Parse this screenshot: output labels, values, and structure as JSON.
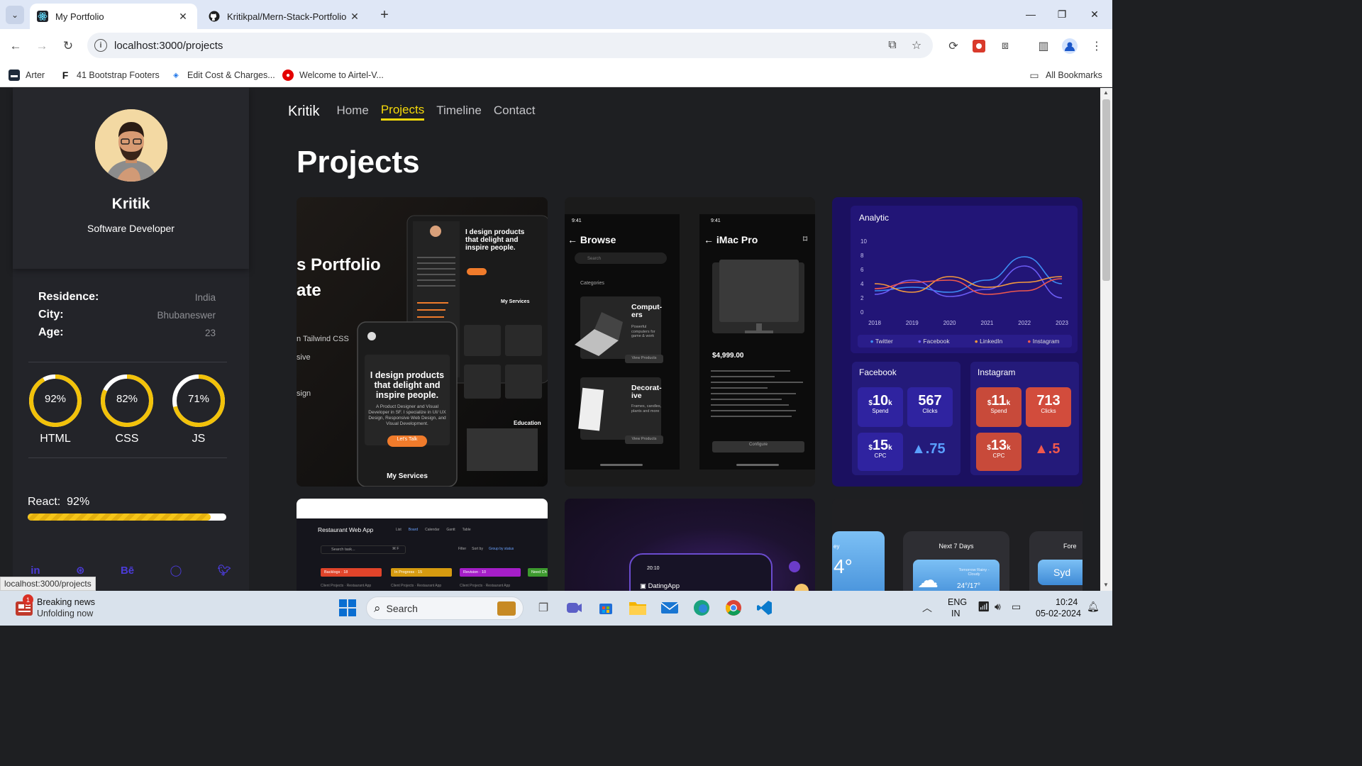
{
  "browser": {
    "tabs": [
      {
        "title": "My Portfolio",
        "active": true
      },
      {
        "title": "Kritikpal/Mern-Stack-Portfolio",
        "active": false
      }
    ],
    "url": "localhost:3000/projects",
    "bookmarks": [
      "Arter",
      "41 Bootstrap Footers",
      "Edit Cost & Charges...",
      "Welcome to Airtel-V..."
    ],
    "all_bookmarks": "All Bookmarks",
    "status_url": "localhost:3000/projects"
  },
  "sidebar": {
    "name": "Kritik",
    "role": "Software Developer",
    "info": [
      {
        "key": "Residence:",
        "value": "India"
      },
      {
        "key": "City:",
        "value": "Bhubaneswer"
      },
      {
        "key": "Age:",
        "value": "23"
      }
    ],
    "skills": [
      {
        "label": "HTML",
        "percent": "92%",
        "value": 0.92
      },
      {
        "label": "CSS",
        "percent": "82%",
        "value": 0.82
      },
      {
        "label": "JS",
        "percent": "71%",
        "value": 0.71
      }
    ],
    "bar_skill": {
      "label": "React:",
      "percent": "92%",
      "value": 0.92
    },
    "socials": [
      "in",
      "dribbble",
      "Bē",
      "github",
      "twitter"
    ]
  },
  "nav": {
    "brand": "Kritik",
    "links": [
      "Home",
      "Projects",
      "Timeline",
      "Contact"
    ],
    "active": "Projects"
  },
  "page_title": "Projects",
  "projects": {
    "portfolio": {
      "heading_partial_1": "s Portfolio",
      "heading_partial_2": "ate",
      "side_line_1": "n Tailwind CSS",
      "side_line_2": "sive",
      "side_line_3": "sign",
      "hero": "I design products that delight and inspire people.",
      "hero_small": "I design products that delight and inspire people.",
      "hero_desc": "A Product Designer and Visual Developer in SF. I specialize in UI/ UX Design, Responsive Web Design, and Visual Development.",
      "cta": "Let's Talk",
      "services": "My Services",
      "services_small": "My Services",
      "education": "Education"
    },
    "shop": {
      "time": "9:41",
      "browse": "Browse",
      "search_placeholder": "Search",
      "categories": "Categories",
      "cat1_title": "Comput-ers",
      "cat1_desc": "Powerful computers for game & work",
      "cat2_title": "Decorat-ive",
      "cat2_desc": "Frames, candles, plants and more",
      "view_products": "View Products",
      "product_title": "iMac Pro",
      "price": "$4,999.00",
      "configure": "Configure"
    },
    "analytics": {
      "title": "Analytic",
      "legend": [
        "Twitter",
        "Facebook",
        "LinkedIn",
        "Instagram"
      ],
      "facebook_title": "Facebook",
      "instagram_title": "Instagram",
      "fb_spend": "10",
      "fb_spend_label": "Spend",
      "fb_clicks": "567",
      "fb_clicks_label": "Clicks",
      "fb_cpc": "15",
      "fb_cpc_label": "CPC",
      "fb_delta": "▲.75",
      "ig_spend": "11",
      "ig_spend_label": "Spend",
      "ig_clicks": "713",
      "ig_clicks_label": "Clicks",
      "ig_cpc": "13",
      "ig_cpc_label": "CPC",
      "ig_delta": "▲.5",
      "k_unit": "k",
      "currency": "$"
    },
    "restaurant": {
      "title": "Restaurant Web App",
      "views": [
        "List",
        "Board",
        "Calendar",
        "Gantt",
        "Table"
      ],
      "search": "Search task...",
      "shortcut": "⌘ F",
      "controls": [
        "Filter",
        "Sort by",
        "Group by status"
      ],
      "columns": [
        "Backlogs",
        "In Progress",
        "Revision",
        "Need Ch"
      ],
      "column_counts": [
        "18",
        "15",
        "10"
      ],
      "tag": "Client Projects",
      "tag_detail": "Restaurant App"
    },
    "dating": {
      "time": "20:10",
      "app": "DatingApp"
    },
    "weather": {
      "next_days": "Next 7 Days",
      "forecast": "Fore",
      "left_label": "ey",
      "temp": "4°",
      "range": "24°/17°",
      "condition": "Tomorrow Rainy - Cloudy",
      "city": "Syd"
    }
  },
  "chart_data": {
    "type": "line",
    "title": "Analytic",
    "x": [
      "2018",
      "2019",
      "2020",
      "2021",
      "2022",
      "2023"
    ],
    "yticks": [
      "0",
      "2",
      "4",
      "6",
      "8",
      "10"
    ],
    "ylim": [
      0,
      10
    ],
    "series": [
      {
        "name": "Twitter",
        "color": "#3d8ff5",
        "values": [
          3.0,
          3.5,
          2.8,
          4.5,
          7.8,
          4.0
        ]
      },
      {
        "name": "Facebook",
        "color": "#6b5cf5",
        "values": [
          2.5,
          4.5,
          2.2,
          3.2,
          6.5,
          2.0
        ]
      },
      {
        "name": "LinkedIn",
        "color": "#f59a3d",
        "values": [
          4.0,
          2.8,
          5.0,
          3.5,
          4.2,
          5.0
        ]
      },
      {
        "name": "Instagram",
        "color": "#f0584d",
        "values": [
          3.3,
          4.2,
          4.5,
          2.5,
          3.0,
          4.7
        ]
      }
    ]
  },
  "taskbar": {
    "news_title": "Breaking news",
    "news_sub": "Unfolding now",
    "news_badge": "1",
    "search": "Search",
    "lang": "ENG",
    "region": "IN",
    "time": "10:24",
    "date": "05-02-2024"
  }
}
